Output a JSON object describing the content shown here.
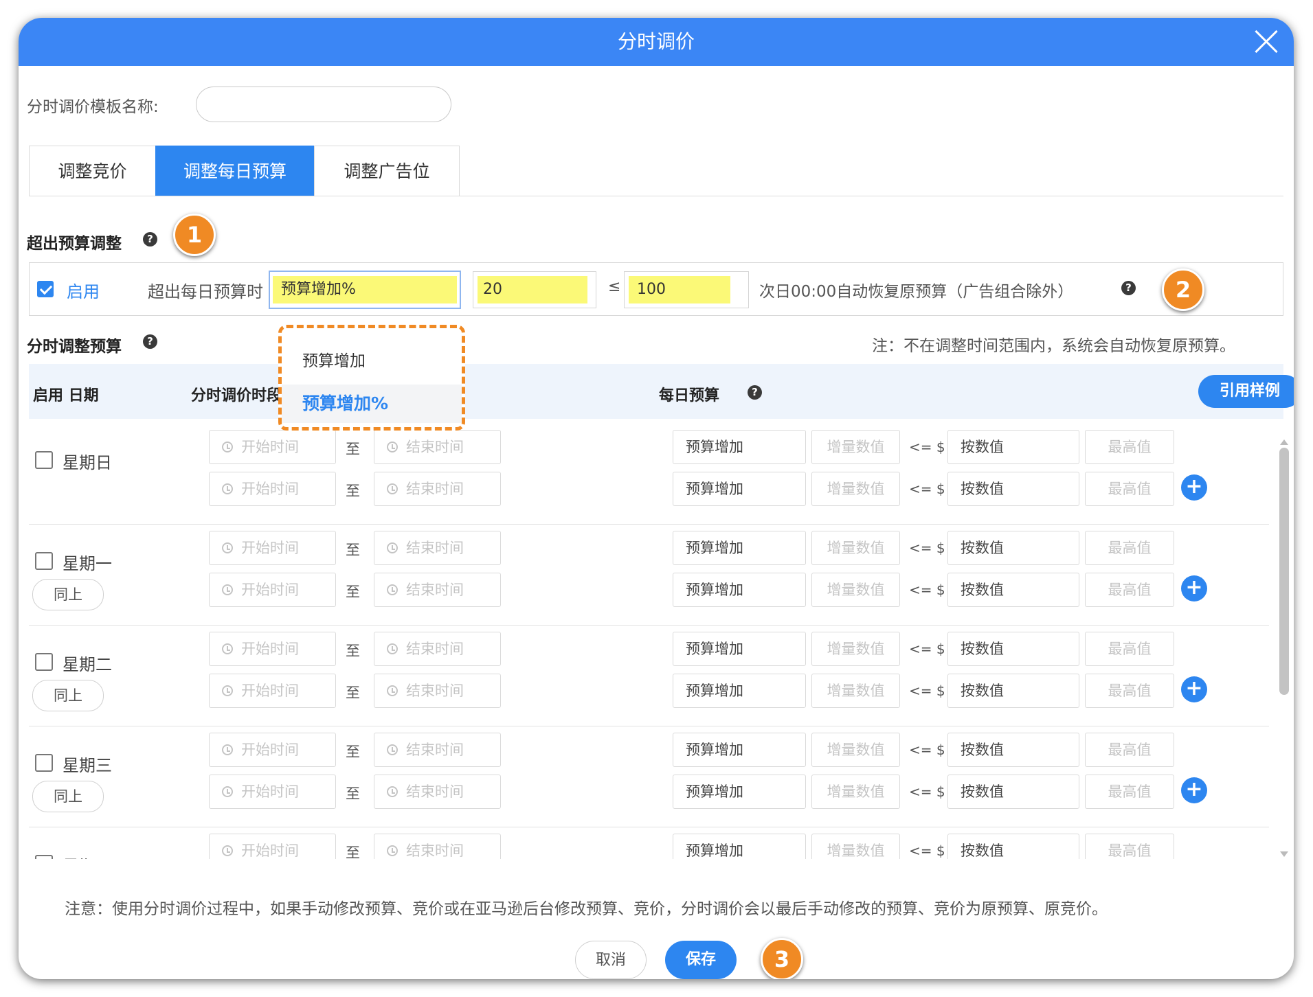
{
  "dialog": {
    "title": "分时调价"
  },
  "template": {
    "name_label": "分时调价模板名称:",
    "name_value": "",
    "name_placeholder": ""
  },
  "tabs": [
    {
      "label": "调整竞价",
      "active": false
    },
    {
      "label": "调整每日预算",
      "active": true
    },
    {
      "label": "调整广告位",
      "active": false
    }
  ],
  "markers": [
    "1",
    "2",
    "3"
  ],
  "over_budget": {
    "section_title": "超出预算调整",
    "enable_label": "启用",
    "enabled": true,
    "when_label": "超出每日预算时",
    "mode_value": "预算增加%",
    "amount_value": "20",
    "le_symbol": "≤",
    "limit_value": "100",
    "restore_text": "次日00:00自动恢复原预算（广告组合除外）"
  },
  "dropdown": {
    "options": [
      {
        "label": "预算增加",
        "selected": false
      },
      {
        "label": "预算增加%",
        "selected": true
      }
    ]
  },
  "timeslot": {
    "section_title": "分时调整预算",
    "note": "注：不在调整时间范围内，系统会自动恢复原预算。",
    "headers": {
      "enable_date": "启用 日期",
      "time_period": "分时调价时段",
      "daily_budget": "每日预算"
    },
    "example_button": "引用样例",
    "same_button": "同上",
    "slot": {
      "start_placeholder": "开始时间",
      "to": "至",
      "end_placeholder": "结束时间",
      "mode": "预算增加",
      "increment_placeholder": "增量数值",
      "le_dollar": "<= $",
      "by_value": "按数值",
      "max_placeholder": "最高值"
    },
    "days": [
      {
        "label": "星期日",
        "same_as_above": false
      },
      {
        "label": "星期一",
        "same_as_above": true
      },
      {
        "label": "星期二",
        "same_as_above": true
      },
      {
        "label": "星期三",
        "same_as_above": true
      },
      {
        "label": "星期四",
        "same_as_above": true
      }
    ]
  },
  "footer": {
    "notice": "注意：使用分时调价过程中，如果手动修改预算、竞价或在亚马逊后台修改预算、竞价，分时调价会以最后手动修改的预算、竞价为原预算、原竞价。",
    "cancel": "取消",
    "save": "保存"
  },
  "colors": {
    "primary": "#2d86f0",
    "title_bar": "#3b86f5",
    "highlight": "#fbf977",
    "marker": "#f08a24"
  }
}
